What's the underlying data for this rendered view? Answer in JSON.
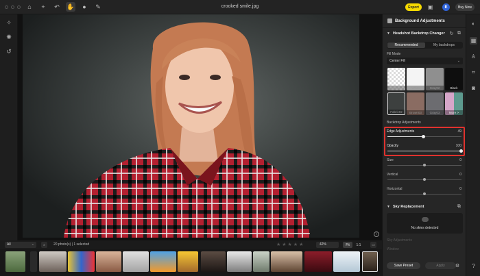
{
  "window": {
    "title": "crooked smile.jpg"
  },
  "toolbar": {
    "export_label": "Export",
    "user_initial": "E",
    "buy_now_label": "Buy Now"
  },
  "panel": {
    "title": "Background Adjustments",
    "backdrop_section": "Headshot Backdrop Changer",
    "tabs": [
      {
        "label": "Recommended",
        "active": true
      },
      {
        "label": "My backdrops",
        "active": false
      }
    ],
    "fill_mode_label": "Fill Mode",
    "fill_mode_value": "Center Fill",
    "swatches": [
      {
        "label": "Transp.",
        "color": "#bdbdbd",
        "selected": false
      },
      {
        "label": "White",
        "color": "#f4f4f4",
        "selected": false
      },
      {
        "label": "Gray02",
        "color": "#8f8f8f",
        "selected": false
      },
      {
        "label": "Black",
        "color": "#0e0e0e",
        "selected": false
      },
      {
        "label": "Fabric02",
        "color": "#3d403f",
        "selected": true
      },
      {
        "label": "Brown03",
        "color": "#8a6c62",
        "selected": false
      },
      {
        "label": "Gray03",
        "color": "#6c6c70",
        "selected": false
      },
      {
        "label": "More >",
        "color": "#6a8f8a",
        "selected": false
      }
    ],
    "backdrop_adjustments_label": "Backdrop Adjustments",
    "edge_adjustments": {
      "label": "Edge Adjustments",
      "value": 49,
      "fraction": 0.49
    },
    "opacity": {
      "label": "Opacity",
      "value": 100,
      "fraction": 1.0
    },
    "size": {
      "label": "Size",
      "value": 0
    },
    "vertical": {
      "label": "Vertical",
      "value": 0
    },
    "horizontal": {
      "label": "Horizontal",
      "value": 0
    },
    "sky_section": "Sky Replacement",
    "no_skies": "No skies detected",
    "sky_adjustments_label": "Sky Adjustments",
    "sky_window_label": "Window",
    "save_preset_label": "Save Preset",
    "apply_label": "Apply"
  },
  "filmstrip": {
    "filter_value": "All",
    "photo_count": "20 photo(s) | 1 selected",
    "zoom": "42%",
    "fit_label": "Fit",
    "one_to_one_label": "1:1"
  },
  "colors": {
    "accent": "#f5d900",
    "highlight_box": "#e0322e",
    "avatar": "#2f63d8"
  },
  "icons": [
    "home-icon",
    "plus-icon",
    "undo-icon",
    "hand-icon",
    "heal-icon",
    "eraser-icon",
    "magic-icon",
    "sun-icon",
    "history-icon",
    "save-icon",
    "filter-icon",
    "info-icon",
    "refresh-icon",
    "compare-icon",
    "help-icon",
    "camera-icon",
    "shirt-icon",
    "crop-icon"
  ]
}
